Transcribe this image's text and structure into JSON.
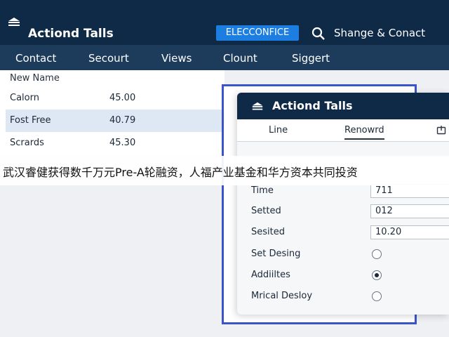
{
  "window": {
    "title": "Actiond Talls",
    "badge": "ELECCONFICE",
    "search_label": "Shange & Conact"
  },
  "menu": [
    "Contact",
    "Secourt",
    "Views",
    "Clount",
    "Siggert"
  ],
  "list": {
    "header": "New Name",
    "rows": [
      {
        "name": "Calorn",
        "value": "45.00"
      },
      {
        "name": "Fost Free",
        "value": "40.79"
      },
      {
        "name": "Scrards",
        "value": "45.30"
      }
    ]
  },
  "dialog": {
    "title": "Actiond Talls",
    "tabs": [
      "Line",
      "Renowrd"
    ],
    "fields": [
      {
        "label": "Time",
        "value": "711"
      },
      {
        "label": "Setted",
        "value": "012"
      },
      {
        "label": "Sesited",
        "value": "10.20"
      }
    ],
    "options": [
      {
        "label": "Set Desing",
        "selected": false
      },
      {
        "label": "Addiiltes",
        "selected": true
      },
      {
        "label": "Mrical Desloy",
        "selected": false
      }
    ]
  },
  "caption": "武汉睿健获得数千万元Pre-A轮融资，人福产业基金和华方资本共同投资",
  "colors": {
    "titlebar": "#0e2a47",
    "menubar": "#1d3c5c",
    "accent": "#1b7ee0",
    "frame": "#3a55c9"
  }
}
